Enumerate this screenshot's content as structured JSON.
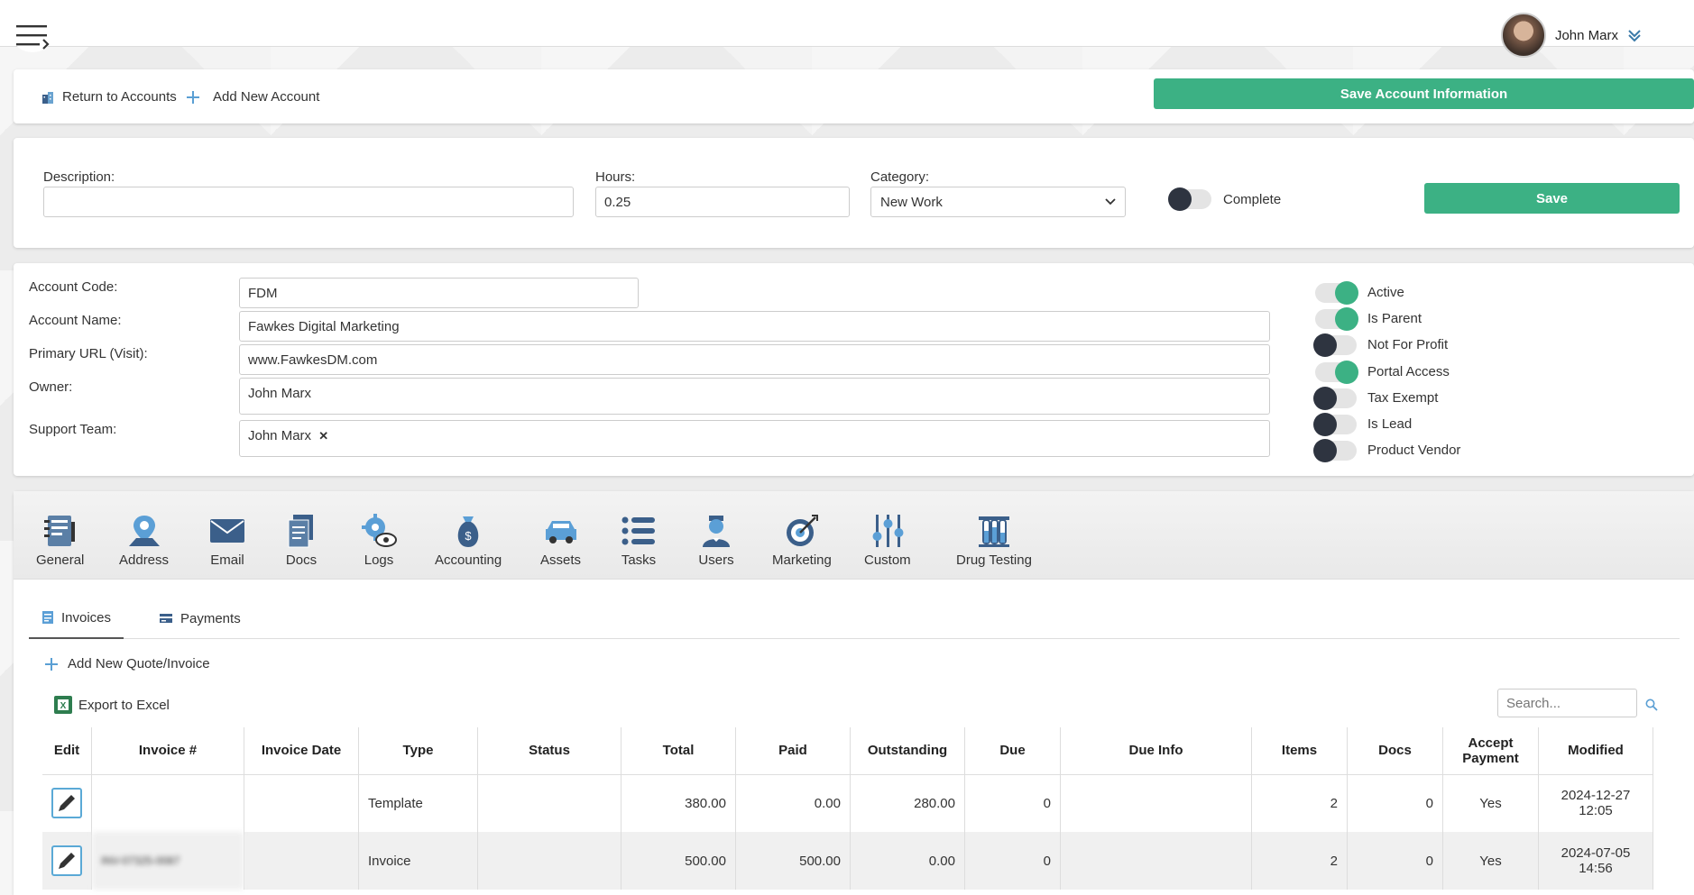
{
  "user": {
    "name": "John Marx"
  },
  "actions": {
    "return_label": "Return to Accounts",
    "add_label": "Add New Account",
    "save_account_label": "Save Account Information"
  },
  "time_entry": {
    "description_label": "Description:",
    "description_value": "",
    "hours_label": "Hours:",
    "hours_value": "0.25",
    "category_label": "Category:",
    "category_value": "New Work",
    "complete_label": "Complete",
    "complete_on": false,
    "save_label": "Save"
  },
  "account": {
    "code_label": "Account Code:",
    "code_value": "FDM",
    "name_label": "Account Name:",
    "name_value": "Fawkes Digital Marketing",
    "url_label": "Primary URL (Visit):",
    "url_value": "www.FawkesDM.com",
    "owner_label": "Owner:",
    "owner_value": "John Marx",
    "support_label": "Support Team:",
    "support_member": "John Marx",
    "remove_glyph": "✕"
  },
  "flags": [
    {
      "label": "Active",
      "on": true
    },
    {
      "label": "Is Parent",
      "on": true
    },
    {
      "label": "Not For Profit",
      "on": false
    },
    {
      "label": "Portal Access",
      "on": true
    },
    {
      "label": "Tax Exempt",
      "on": false
    },
    {
      "label": "Is Lead",
      "on": false
    },
    {
      "label": "Product Vendor",
      "on": false
    }
  ],
  "module_tabs": [
    {
      "label": "General",
      "icon": "notebook-icon"
    },
    {
      "label": "Address",
      "icon": "map-pin-icon"
    },
    {
      "label": "Email",
      "icon": "envelope-icon"
    },
    {
      "label": "Docs",
      "icon": "documents-icon"
    },
    {
      "label": "Logs",
      "icon": "gear-eye-icon"
    },
    {
      "label": "Accounting",
      "icon": "money-bag-icon"
    },
    {
      "label": "Assets",
      "icon": "car-icon"
    },
    {
      "label": "Tasks",
      "icon": "list-icon"
    },
    {
      "label": "Users",
      "icon": "user-icon"
    },
    {
      "label": "Marketing",
      "icon": "target-icon"
    },
    {
      "label": "Custom",
      "icon": "sliders-icon"
    },
    {
      "label": "Drug Testing",
      "icon": "test-tubes-icon"
    }
  ],
  "subtabs": {
    "invoices": "Invoices",
    "payments": "Payments"
  },
  "invoices": {
    "add_label": "Add New Quote/Invoice",
    "export_label": "Export to Excel",
    "search_placeholder": "Search...",
    "columns": [
      "Edit",
      "Invoice #",
      "Invoice Date",
      "Type",
      "Status",
      "Total",
      "Paid",
      "Outstanding",
      "Due",
      "Due Info",
      "Items",
      "Docs",
      "Accept Payment",
      "Modified"
    ],
    "rows": [
      {
        "invoice_no": "",
        "invoice_date": "",
        "type": "Template",
        "status": "",
        "total": "380.00",
        "paid": "0.00",
        "outstanding": "280.00",
        "due": "0",
        "due_info": "",
        "items": "2",
        "docs": "0",
        "accept": "Yes",
        "modified_date": "2024-12-27",
        "modified_time": "12:05"
      },
      {
        "invoice_no": "INV-07325-0087",
        "invoice_date": "",
        "type": "Invoice",
        "status": "",
        "total": "500.00",
        "paid": "500.00",
        "outstanding": "0.00",
        "due": "0",
        "due_info": "",
        "items": "2",
        "docs": "0",
        "accept": "Yes",
        "modified_date": "2024-07-05",
        "modified_time": "14:56"
      }
    ]
  }
}
